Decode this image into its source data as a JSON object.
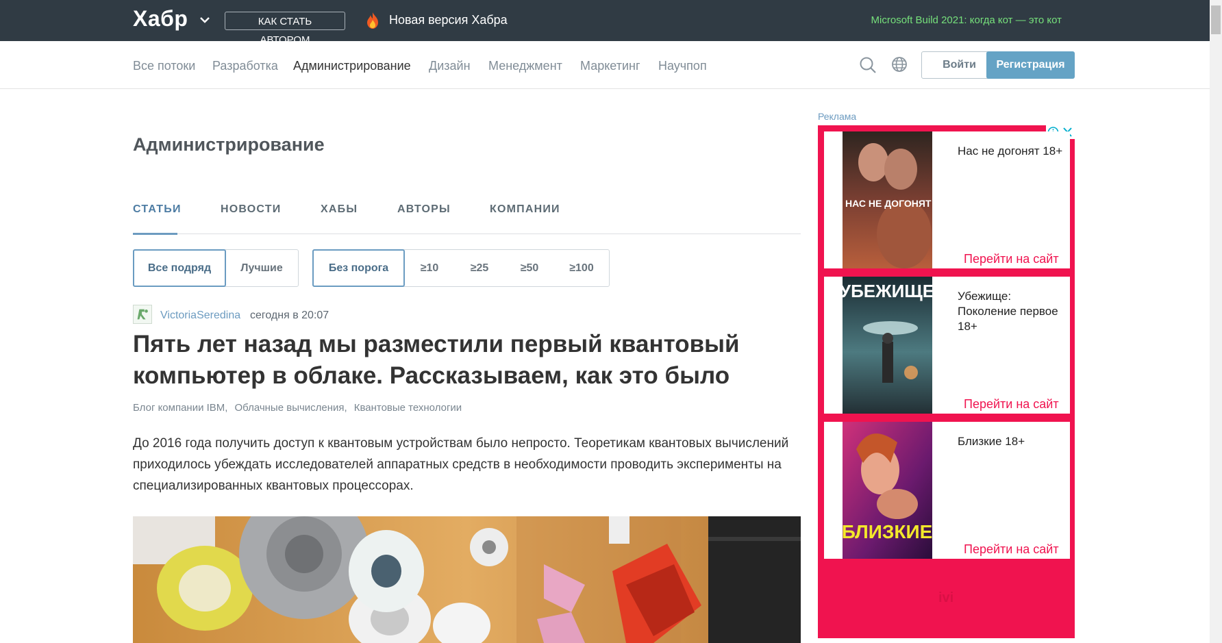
{
  "header": {
    "logo": "Хабр",
    "author_button": "КАК СТАТЬ АВТОРОМ",
    "new_version": "Новая версия Хабра",
    "promo": "Microsoft Build 2021: когда кот — это кот"
  },
  "nav": {
    "items": [
      "Все потоки",
      "Разработка",
      "Администрирование",
      "Дизайн",
      "Менеджмент",
      "Маркетинг",
      "Научпоп"
    ],
    "active": "Администрирование",
    "login": "Войти",
    "register": "Регистрация"
  },
  "page": {
    "title": "Администрирование",
    "tabs": [
      "СТАТЬИ",
      "НОВОСТИ",
      "ХАБЫ",
      "АВТОРЫ",
      "КОМПАНИИ"
    ],
    "active_tab": "СТАТЬИ",
    "filters_sort": [
      "Все подряд",
      "Лучшие"
    ],
    "filters_threshold": [
      "Без порога",
      "≥10",
      "≥25",
      "≥50",
      "≥100"
    ]
  },
  "post": {
    "author": "VictoriaSeredina",
    "time": "сегодня в 20:07",
    "title": "Пять лет назад мы разместили первый квантовый компьютер в облаке. Рассказываем, как это было",
    "hubs": [
      "Блог компании IBM,",
      "Облачные вычисления,",
      "Квантовые технологии"
    ],
    "text": "До 2016 года получить доступ к квантовым устройствам было непросто. Теоретикам квантовых вычислений приходилось убеждать исследователей аппаратных средств в необходимости проводить эксперименты на специализированных квантовых процессорах."
  },
  "ad": {
    "label": "Реклама",
    "cards": [
      {
        "title": "Нас не догонят 18+",
        "link": "Перейти на сайт",
        "poster_text": "НАС НЕ ДОГОНЯТ"
      },
      {
        "title": "Убежище: Поколение первое 18+",
        "link": "Перейти на сайт",
        "poster_text": "УБЕЖИЩЕ"
      },
      {
        "title": "Близкие 18+",
        "link": "Перейти на сайт",
        "poster_text": "БЛИЗКИЕ"
      }
    ],
    "brand": "ivi"
  },
  "colors": {
    "topbar": "#303b44",
    "promo": "#76e07b",
    "accent": "#65a3c5",
    "ad": "#f0134f"
  }
}
